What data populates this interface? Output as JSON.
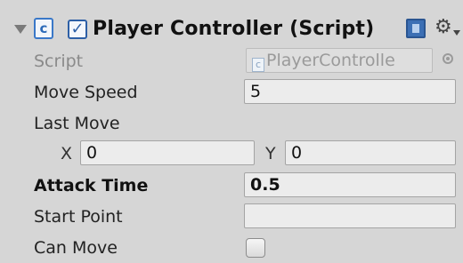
{
  "component": {
    "title": "Player Controller (Script)",
    "enabled": true,
    "icons": {
      "fold": "triangle-down-icon",
      "script": "script-icon",
      "help": "help-book-icon",
      "settings": "gear-icon"
    }
  },
  "fields": {
    "script": {
      "label": "Script",
      "value": "PlayerControlle"
    },
    "move_speed": {
      "label": "Move Speed",
      "value": "5"
    },
    "last_move": {
      "label": "Last Move",
      "x_label": "X",
      "x_value": "0",
      "y_label": "Y",
      "y_value": "0"
    },
    "attack_time": {
      "label": "Attack Time",
      "value": "0.5"
    },
    "start_point": {
      "label": "Start Point",
      "value": ""
    },
    "can_move": {
      "label": "Can Move",
      "checked": false
    }
  }
}
